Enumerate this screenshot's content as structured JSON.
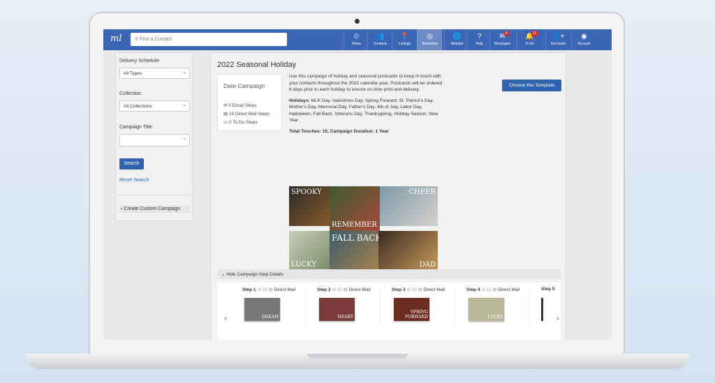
{
  "nav": {
    "logo": "ml",
    "search_placeholder": "Find a Contact",
    "items": [
      {
        "label": "Home",
        "icon": "⏲"
      },
      {
        "label": "Contacts",
        "icon": "👥"
      },
      {
        "label": "Listings",
        "icon": "📍"
      },
      {
        "label": "Marketing",
        "icon": "◎",
        "active": true
      },
      {
        "label": "Website",
        "icon": "🌐"
      },
      {
        "label": "Help",
        "icon": "?"
      },
      {
        "label": "Messages",
        "icon": "✉",
        "badge": "8"
      },
      {
        "label": "To Do",
        "icon": "🔔",
        "badge": "12"
      },
      {
        "label": "Get leads",
        "icon": "👤+"
      },
      {
        "label": "Account",
        "icon": "◉"
      }
    ]
  },
  "sidebar": {
    "delivery_label": "Delivery Schedule:",
    "delivery_value": "All Types",
    "collection_label": "Collection:",
    "collection_value": "All Collections",
    "title_label": "Campaign Title:",
    "title_value": "",
    "search_button": "Search",
    "reset_link": "Reset Search",
    "custom_campaign": "Create Custom Campaign"
  },
  "campaign": {
    "title": "2022 Seasonal Holiday",
    "type": "Date Campaign",
    "email_steps": "0 Email Steps",
    "mail_steps": "15 Direct Mail Steps",
    "todo_steps": "0 To Do Steps",
    "description": "Use this campaign of holiday and seasonal postcards to keep in touch with your contacts throughout the 2022 calendar year. Postcards will be ordered 8 days prior to each holiday to ensure on-time print and delivery.",
    "holidays_label": "Holidays:",
    "holidays": "MLK Day, Valentines Day, Spring Forward, St. Patrick's Day, Mother's Day, Memorial Day, Father's Day, 4th of July, Labor Day, Halloween, Fall Back, Veterans Day, Thanksgiving, Holiday Season, New Year",
    "totals": "Total Touches: 15, Campaign Duration: 1 Year",
    "choose_button": "Choose this Template",
    "postcards": [
      "SPOOKY",
      "CHEER",
      "REMEMBER",
      "LUCKY",
      "FALL BACK",
      "DAD"
    ]
  },
  "steps": {
    "toggle": "Hide Campaign Step Details",
    "items": [
      {
        "step": "Step 1",
        "of": "of 15",
        "type": "Direct Mail",
        "card": "DREAM",
        "color": "#777"
      },
      {
        "step": "Step 2",
        "of": "of 15",
        "type": "Direct Mail",
        "card": "HEART",
        "color": "#7a3b3b"
      },
      {
        "step": "Step 3",
        "of": "of 15",
        "type": "Direct Mail",
        "card": "SPRING FORWARD",
        "color": "#6b2c22"
      },
      {
        "step": "Step 4",
        "of": "of 15",
        "type": "Direct Mail",
        "card": "LUCKY",
        "color": "#b9b79a"
      },
      {
        "step": "Step 5",
        "of": "",
        "type": "",
        "card": "",
        "color": "#333"
      }
    ]
  }
}
